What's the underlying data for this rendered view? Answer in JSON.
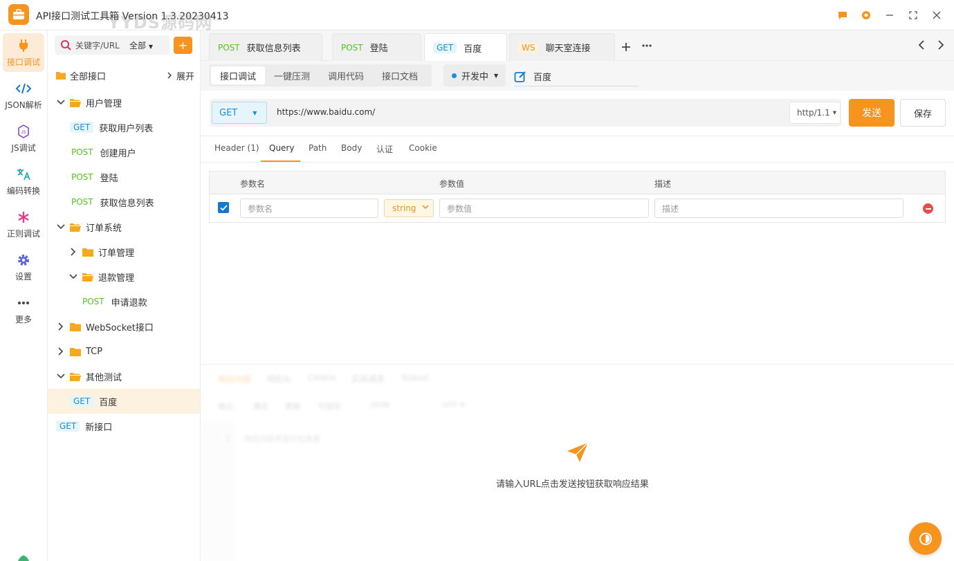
{
  "app": {
    "title": "API接口测试工具箱 Version 1.3.20230413",
    "watermark": "YYDS源码网",
    "colors": {
      "accent": "#f7941d",
      "get": "#1890d5",
      "post": "#52c41a",
      "danger": "#e84c4c"
    }
  },
  "window_controls": [
    "chat-icon",
    "support-icon",
    "minimize-icon",
    "maximize-icon",
    "close-icon"
  ],
  "nav": {
    "items": [
      {
        "label": "接口调试",
        "icon": "plug-icon"
      },
      {
        "label": "JSON解析",
        "icon": "code-icon"
      },
      {
        "label": "JS调试",
        "icon": "js-icon"
      },
      {
        "label": "编码转换",
        "icon": "translate-icon"
      },
      {
        "label": "正则调试",
        "icon": "asterisk-icon"
      },
      {
        "label": "设置",
        "icon": "gear-icon"
      },
      {
        "label": "更多",
        "icon": "more-icon"
      }
    ]
  },
  "sidebar": {
    "search_placeholder": "关键字/URL",
    "scope": "全部",
    "add": "+",
    "all_label": "全部接口",
    "expand_label": "展开",
    "tree": [
      {
        "type": "folder",
        "label": "用户管理",
        "open": true
      },
      {
        "type": "api",
        "method": "GET",
        "label": "获取用户列表"
      },
      {
        "type": "api",
        "method": "POST",
        "label": "创建用户"
      },
      {
        "type": "api",
        "method": "POST",
        "label": "登陆"
      },
      {
        "type": "api",
        "method": "POST",
        "label": "获取信息列表"
      },
      {
        "type": "folder",
        "label": "订单系统",
        "open": true
      },
      {
        "type": "folder",
        "label": "订单管理",
        "open": false
      },
      {
        "type": "folder",
        "label": "退款管理",
        "open": true
      },
      {
        "type": "api",
        "method": "POST",
        "label": "申请退款"
      },
      {
        "type": "folder",
        "label": "WebSocket接口",
        "open": false
      },
      {
        "type": "folder",
        "label": "TCP",
        "open": false
      },
      {
        "type": "folder",
        "label": "其他测试",
        "open": true
      },
      {
        "type": "api",
        "method": "GET",
        "label": "百度",
        "selected": true
      },
      {
        "type": "api",
        "method": "GET",
        "label": "新接口"
      }
    ]
  },
  "request_tabs": [
    {
      "method": "POST",
      "label": "获取信息列表"
    },
    {
      "method": "POST",
      "label": "登陆"
    },
    {
      "method": "GET",
      "label": "百度",
      "active": true
    },
    {
      "method": "WS",
      "label": "聊天室连接"
    }
  ],
  "sub_tabs": [
    "接口调试",
    "一键压测",
    "调用代码",
    "接口文档"
  ],
  "env": {
    "label": "开发中"
  },
  "request_name": "百度",
  "request": {
    "method": "GET",
    "url": "https://www.baidu.com/",
    "protocol": "http/1.1",
    "send_label": "发送",
    "save_label": "保存"
  },
  "param_tabs": [
    "Header (1)",
    "Query",
    "Path",
    "Body",
    "认证",
    "Cookie"
  ],
  "active_param_tab": "Query",
  "query_table": {
    "headers": [
      "参数名",
      "参数值",
      "描述"
    ],
    "row": {
      "checked": true,
      "name_placeholder": "参数名",
      "type": "string",
      "value_placeholder": "参数值",
      "desc_placeholder": "描述"
    }
  },
  "response": {
    "tabs": [
      "响应内容",
      "响应头",
      "Cookie",
      "实际请求",
      "Stdout"
    ],
    "format_label": "格式",
    "view_modes": [
      "美化",
      "原始",
      "可视化"
    ],
    "format": "JSON",
    "encoding": "UTF-8",
    "line_no": "1",
    "editor_placeholder": "响应内容将显示在这里",
    "empty_message": "请输入URL点击发送按钮获取响应结果"
  }
}
